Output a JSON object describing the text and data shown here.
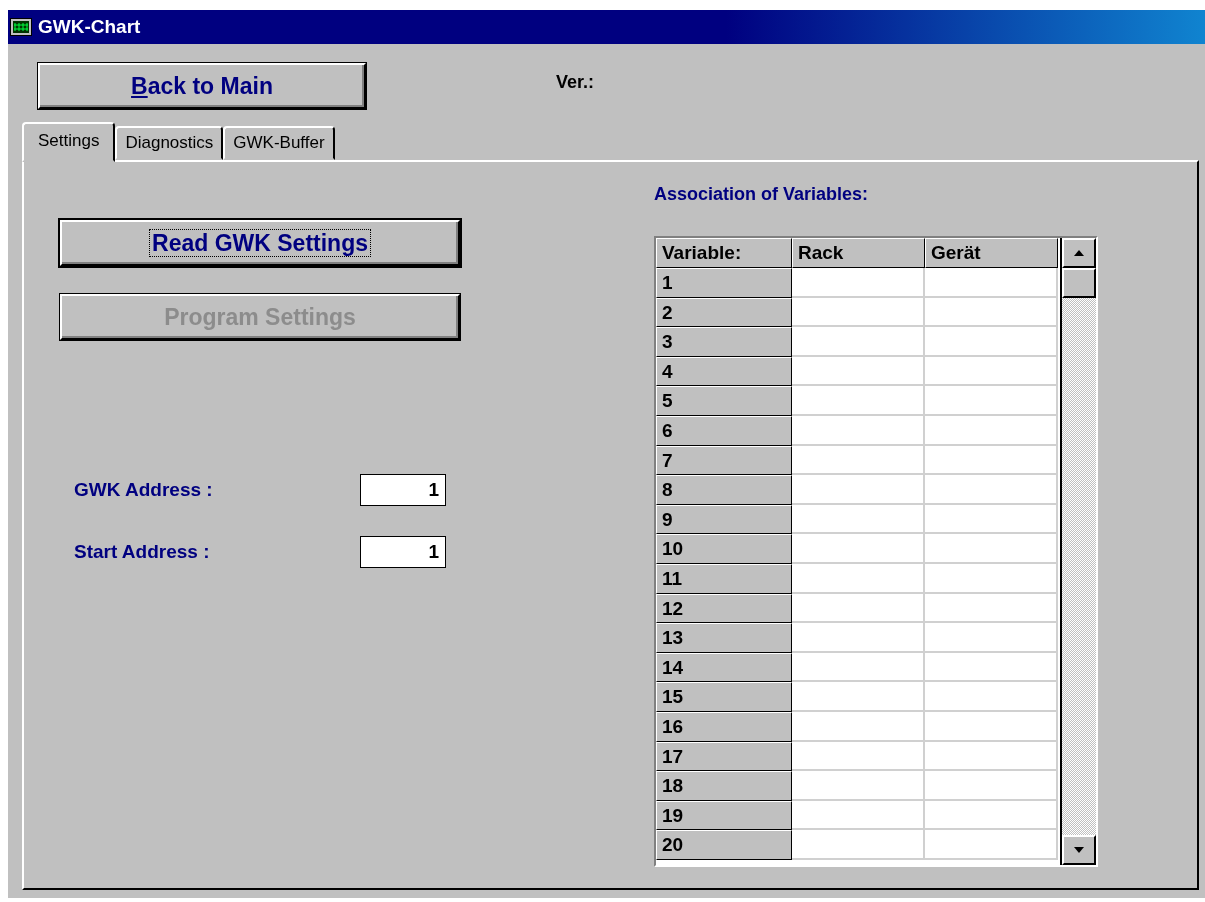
{
  "window": {
    "title": "GWK-Chart"
  },
  "back_button": {
    "label": "Back to Main",
    "first_letter_underlined": true
  },
  "version_label": "Ver.:",
  "tabs": [
    {
      "label": "Settings",
      "selected": true
    },
    {
      "label": "Diagnostics",
      "selected": false
    },
    {
      "label": "GWK-Buffer",
      "selected": false
    }
  ],
  "buttons": [
    {
      "label": "Read GWK Settings",
      "focused": true,
      "disabled": false
    },
    {
      "label": "Program Settings",
      "focused": false,
      "disabled": true
    }
  ],
  "fields": [
    {
      "label": "GWK Address :",
      "value": "1"
    },
    {
      "label": "Start Address :",
      "value": "1"
    }
  ],
  "table": {
    "title": "Association of Variables:",
    "columns": [
      "Variable:",
      "Rack",
      "Gerät"
    ],
    "rows": [
      "1",
      "2",
      "3",
      "4",
      "5",
      "6",
      "7",
      "8",
      "9",
      "10",
      "11",
      "12",
      "13",
      "14",
      "15",
      "16",
      "17",
      "18",
      "19",
      "20"
    ]
  }
}
